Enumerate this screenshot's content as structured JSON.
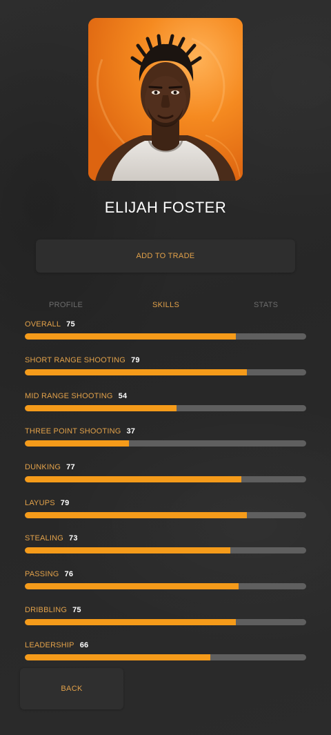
{
  "player": {
    "name": "ELIJAH FOSTER",
    "portrait_icon": "player-portrait",
    "portrait_bg_color": "#f58a20"
  },
  "actions": {
    "add_to_trade": "ADD TO TRADE",
    "back": "BACK"
  },
  "tabs": [
    {
      "label": "PROFILE",
      "active": false
    },
    {
      "label": "SKILLS",
      "active": true
    },
    {
      "label": "STATS",
      "active": false
    }
  ],
  "skills": [
    {
      "label": "OVERALL",
      "value": 75
    },
    {
      "label": "SHORT RANGE SHOOTING",
      "value": 79
    },
    {
      "label": "MID RANGE SHOOTING",
      "value": 54
    },
    {
      "label": "THREE POINT SHOOTING",
      "value": 37
    },
    {
      "label": "DUNKING",
      "value": 77
    },
    {
      "label": "LAYUPS",
      "value": 79
    },
    {
      "label": "STEALING",
      "value": 73
    },
    {
      "label": "PASSING",
      "value": 76
    },
    {
      "label": "DRIBBLING",
      "value": 75
    },
    {
      "label": "LEADERSHIP",
      "value": 66
    }
  ],
  "colors": {
    "accent": "#e3a24a",
    "bar_fill": "#f59b1a",
    "bar_track": "#5f5f5f",
    "background": "#2a2a2a"
  }
}
